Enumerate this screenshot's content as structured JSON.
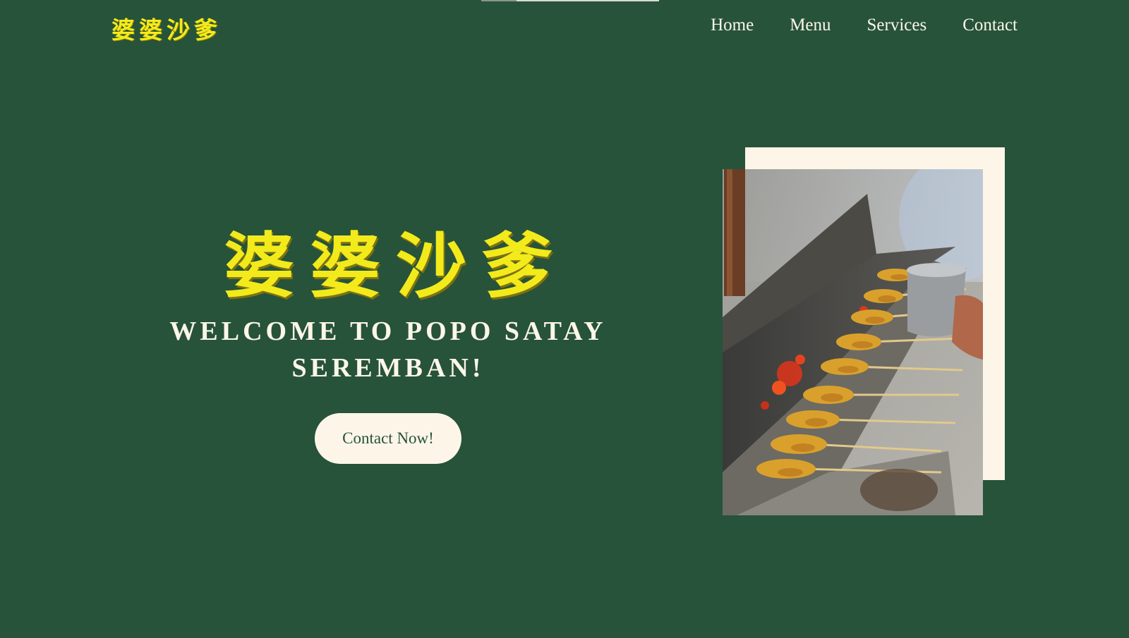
{
  "header": {
    "logo": "婆婆沙爹",
    "nav": [
      "Home",
      "Menu",
      "Services",
      "Contact"
    ]
  },
  "hero": {
    "title_chinese": "婆婆沙爹",
    "welcome": "WELCOME TO POPO SATAY SEREMBAN!",
    "cta_label": "Contact Now!"
  },
  "photo": {
    "subject": "satay skewers grilling over charcoal"
  },
  "colors": {
    "background": "#26533a",
    "accent_yellow": "#f3ea1c",
    "cream": "#fdf6e8"
  }
}
